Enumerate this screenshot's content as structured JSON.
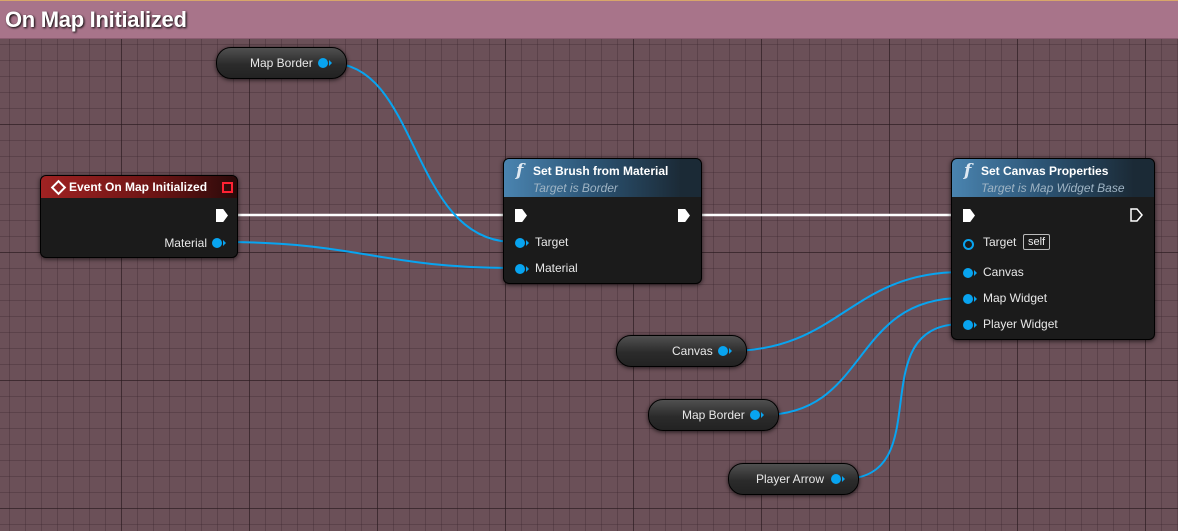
{
  "graph": {
    "title": "On Map Initialized"
  },
  "event_node": {
    "title": "Event On Map Initialized",
    "pins": {
      "material": "Material"
    }
  },
  "set_brush_node": {
    "title": "Set Brush from Material",
    "subtitle": "Target is Border",
    "pins": {
      "target": "Target",
      "material": "Material"
    }
  },
  "set_canvas_node": {
    "title": "Set Canvas Properties",
    "subtitle": "Target is Map Widget Base",
    "pins": {
      "target": "Target",
      "target_default": "self",
      "canvas": "Canvas",
      "map_widget": "Map Widget",
      "player_widget": "Player Widget"
    }
  },
  "variables": {
    "map_border_top": "Map Border",
    "canvas": "Canvas",
    "map_border_bottom": "Map Border",
    "player_arrow": "Player Arrow"
  },
  "colors": {
    "object_pin": "#08a4f0",
    "exec_wire": "#ffffff",
    "event_header": "#a02222",
    "function_header": "#4a84b0",
    "graph_header": "#a8748a"
  }
}
